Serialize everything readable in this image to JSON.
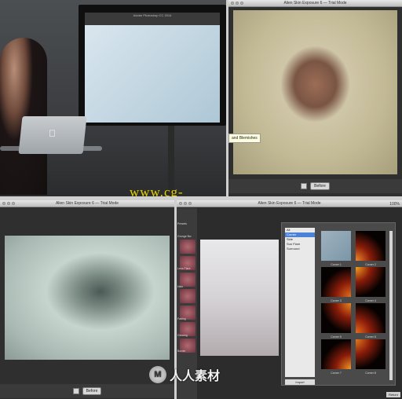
{
  "panels": {
    "studio": {
      "monitor_app_title": "Adobe Photoshop CC 2014",
      "watermark_text": "www.cg-ku.com"
    },
    "top_right": {
      "window_title": "Alien Skin Exposure 6 — Trial Mode",
      "tooltip_text": "and Blemishes",
      "before_label": "Before"
    },
    "bottom_left": {
      "window_title": "Alien Skin Exposure 6 — Trial Mode",
      "before_label": "Before"
    },
    "bottom_right": {
      "window_title": "Alien Skin Exposure 6 — Trial Mode",
      "zoom_label": "100%",
      "file_label": "File",
      "sidebar_tab": "Presets",
      "sidebar_tags": [
        "Grunge Bw",
        "Lens Flare",
        "Halo",
        "Fading",
        "Glowing",
        "Border"
      ],
      "categories": [
        "All",
        "Corner",
        "Side",
        "Sun Flare",
        "Surround"
      ],
      "selected_category": "Corner",
      "import_label": "Import",
      "return_label": "Return",
      "thumbnails": [
        {
          "caption": "Corner 1",
          "color": "#7b96a8"
        },
        {
          "caption": "Corner 2",
          "color": "#f08a2a"
        },
        {
          "caption": "Corner 3",
          "color": "#e0711e"
        },
        {
          "caption": "Corner 4",
          "color": "#f4a11c"
        },
        {
          "caption": "Corner 5",
          "color": "#e8861e"
        },
        {
          "caption": "Corner 6",
          "color": "#ea6d1c"
        },
        {
          "caption": "Corner 7",
          "color": "#f29a24"
        },
        {
          "caption": "Corner 8",
          "color": "#e37b1d"
        }
      ]
    }
  },
  "watermark2": {
    "logo_text": "M",
    "text": "人人素材"
  }
}
